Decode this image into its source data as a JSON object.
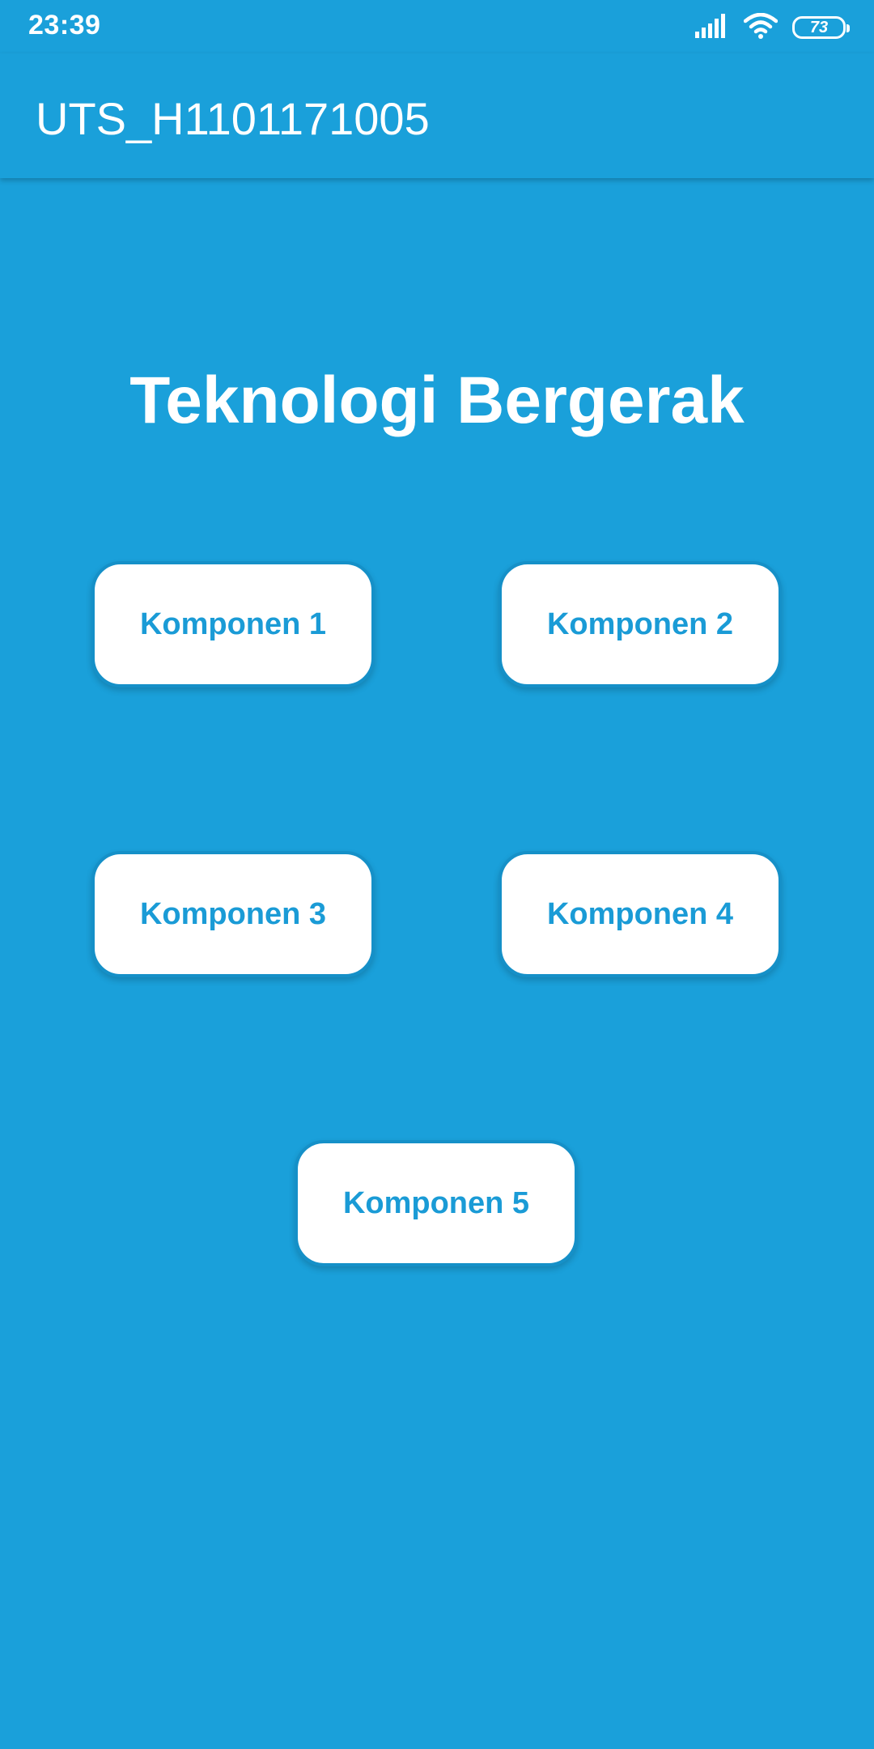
{
  "status_bar": {
    "time": "23:39",
    "battery_level": "73",
    "icons": [
      "signal-icon",
      "wifi-icon",
      "battery-icon"
    ]
  },
  "app_bar": {
    "title": "UTS_H1101171005"
  },
  "main": {
    "heading": "Teknologi Bergerak",
    "buttons": [
      {
        "label": "Komponen 1"
      },
      {
        "label": "Komponen 2"
      },
      {
        "label": "Komponen 3"
      },
      {
        "label": "Komponen 4"
      },
      {
        "label": "Komponen 5"
      }
    ]
  },
  "colors": {
    "background": "#1aa0da",
    "button_background": "#ffffff",
    "button_text": "#1a9bd6",
    "button_border": "#1590c8"
  }
}
